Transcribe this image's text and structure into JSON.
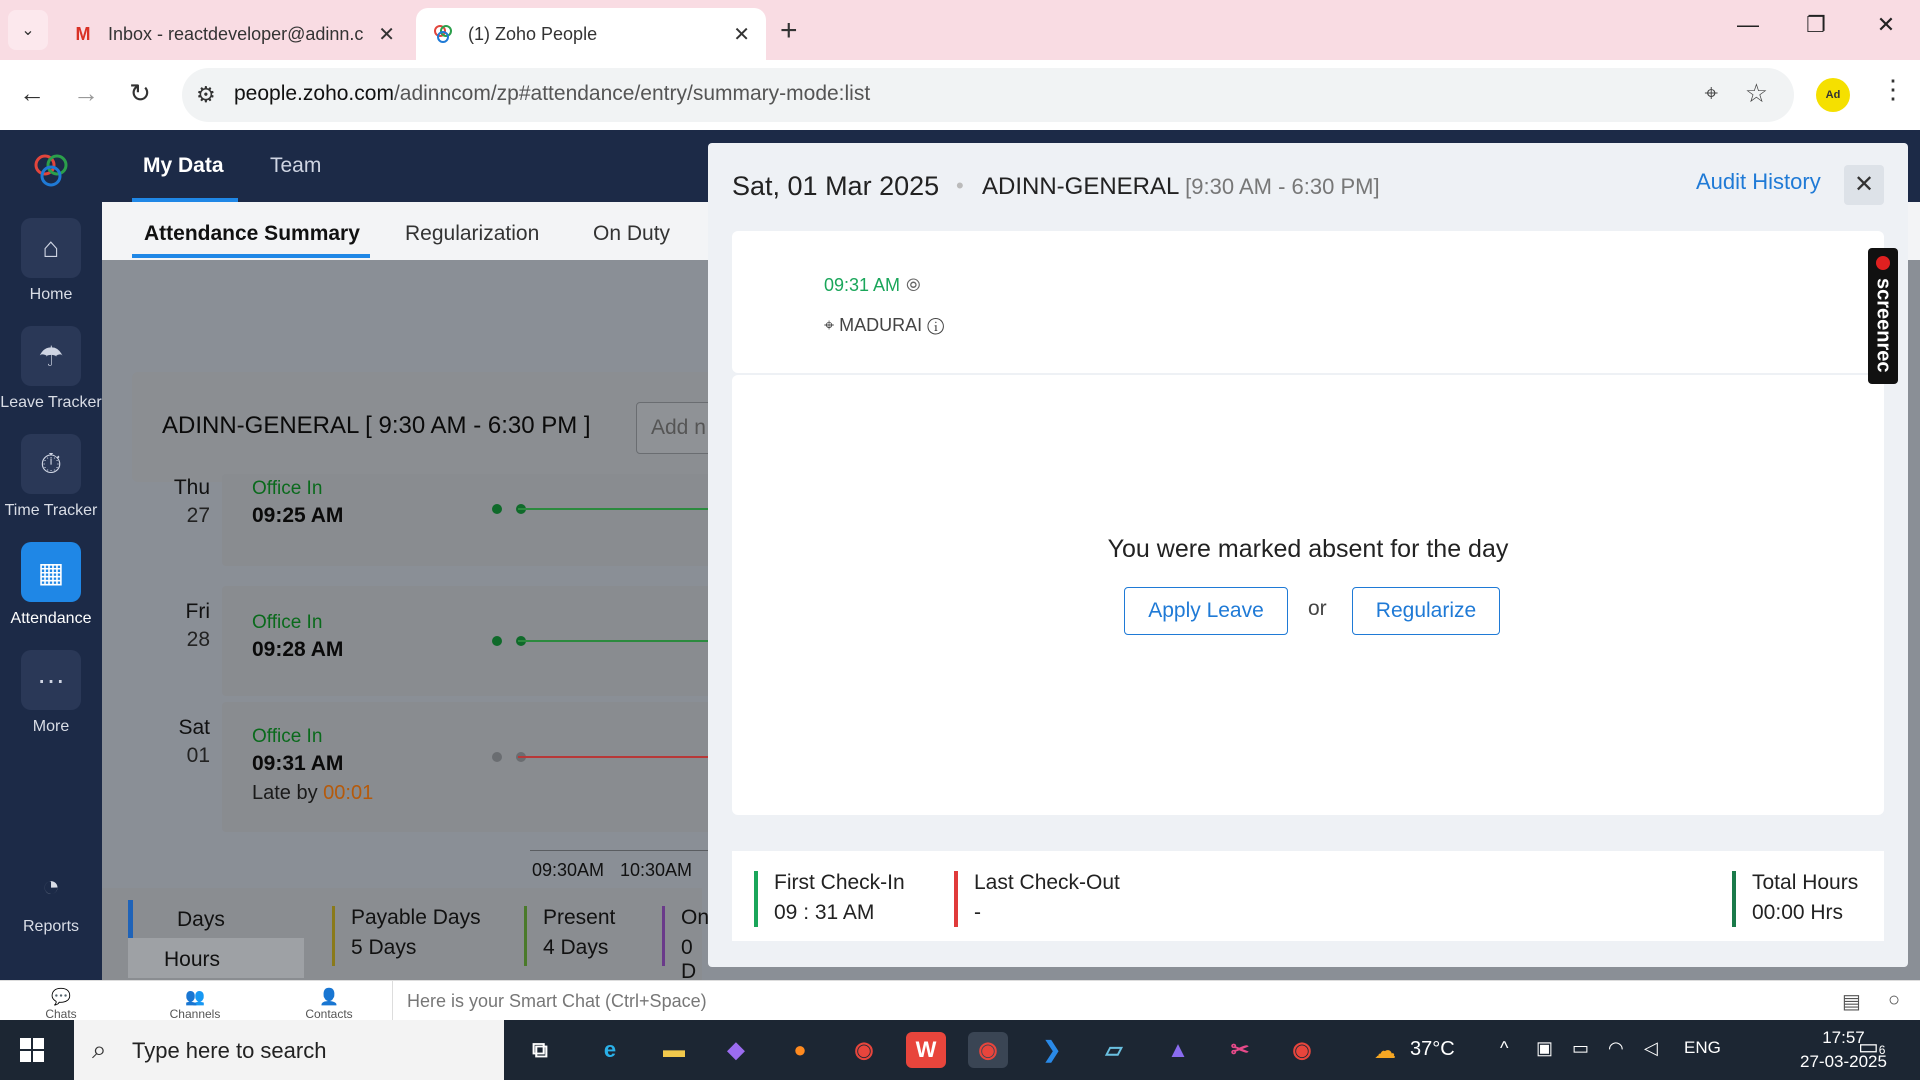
{
  "browser": {
    "tabs": [
      {
        "title": "Inbox - reactdeveloper@adinn.c",
        "favicon": "gmail-icon"
      },
      {
        "title": "(1) Zoho People",
        "favicon": "zoho-icon"
      }
    ],
    "url_host": "people.zoho.com",
    "url_path": "/adinncom/zp#attendance/entry/summary-mode:list"
  },
  "leftnav": {
    "items": [
      {
        "label": "Home",
        "icon": "home-icon"
      },
      {
        "label": "Leave Tracker",
        "icon": "umbrella-icon"
      },
      {
        "label": "Time Tracker",
        "icon": "stopwatch-icon"
      },
      {
        "label": "Attendance",
        "icon": "calendar-icon"
      },
      {
        "label": "More",
        "icon": "more-icon"
      }
    ],
    "reports": "Reports"
  },
  "topbar": {
    "tabs": [
      "My Data",
      "Team"
    ]
  },
  "subtabs": [
    "Attendance Summary",
    "Regularization",
    "On Duty"
  ],
  "shift": {
    "label": "ADINN-GENERAL [ 9:30 AM - 6:30 PM ]",
    "note_placeholder": "Add n"
  },
  "days": [
    {
      "day": "Thu",
      "date": "27",
      "status": "Office In",
      "time": "09:25 AM",
      "late_label": "",
      "late_value": ""
    },
    {
      "day": "Fri",
      "date": "28",
      "status": "Office In",
      "time": "09:28 AM",
      "late_label": "",
      "late_value": ""
    },
    {
      "day": "Sat",
      "date": "01",
      "status": "Office In",
      "time": "09:31 AM",
      "late_label": "Late by ",
      "late_value": "00:01"
    }
  ],
  "time_axis": [
    "09:30AM",
    "10:30AM"
  ],
  "bottom": {
    "days_btn": "Days",
    "hours_btn": "Hours",
    "stats": [
      {
        "label": "Payable Days",
        "value": "5 Days"
      },
      {
        "label": "Present",
        "value": "4 Days"
      },
      {
        "label": "On",
        "value": "0 D"
      }
    ]
  },
  "panel": {
    "date": "Sat, 01 Mar 2025",
    "shift_name": "ADINN-GENERAL",
    "shift_time": "[9:30 AM - 6:30 PM]",
    "audit": "Audit History",
    "checkin_time": "09:31 AM",
    "location": "MADURAI",
    "absent_msg": "You were marked absent for the day",
    "apply_leave": "Apply Leave",
    "or": "or",
    "regularize": "Regularize",
    "summary": [
      {
        "label": "First Check-In",
        "value": "09 : 31 AM",
        "color": "#1aa65a"
      },
      {
        "label": "Last Check-Out",
        "value": "-",
        "color": "#e03a3a"
      },
      {
        "label": "Total Hours",
        "value": "00:00 Hrs",
        "color": "#1a7a4a"
      }
    ]
  },
  "chatbar": {
    "items": [
      "Chats",
      "Channels",
      "Contacts"
    ],
    "placeholder": "Here is your Smart Chat (Ctrl+Space)"
  },
  "screenrec": "screenrec",
  "taskbar": {
    "search_placeholder": "Type here to search",
    "weather": "37°C",
    "lang": "ENG",
    "time": "17:57",
    "date": "27-03-2025",
    "notif_count": "6"
  }
}
